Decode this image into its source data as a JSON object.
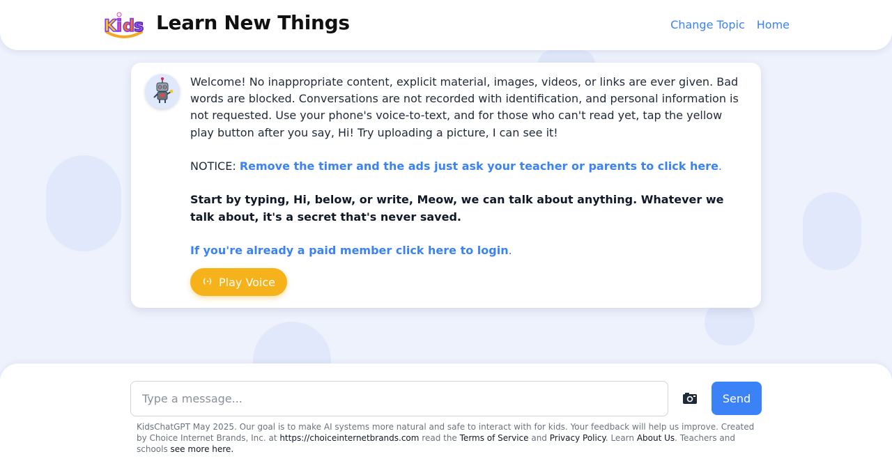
{
  "header": {
    "logo_text": "Kids",
    "title": "Learn New Things",
    "nav": [
      "Change Topic",
      "Home"
    ]
  },
  "message": {
    "intro": "Welcome! No inappropriate content, explicit material, images, videos, or links are ever given. Bad words are blocked. Conversations are not recorded with identification, and personal information is not requested. Use your phone's voice-to-text, and for those who can't read yet, tap the yellow play button after you say, Hi! Try uploading a picture, I can see it!",
    "notice_label": "NOTICE: ",
    "notice_link": "Remove the timer and the ads just ask your teacher or parents to click here",
    "notice_period": ".",
    "start_text": "Start by typing, Hi, below, or write, Meow, we can talk about anything. Whatever we talk about, it's a secret that's never saved.",
    "login_link": "If you're already a paid member click here to login",
    "login_period": ".",
    "play_button": "Play Voice"
  },
  "input": {
    "placeholder": "Type a message...",
    "value": "",
    "send_label": "Send"
  },
  "footer": {
    "text1": "KidsChatGPT May 2025. Our goal is to make AI systems more natural and safe to interact with for kids. Your feedback will help us improve. Created by Choice Internet Brands, Inc. at ",
    "site_link": "https://choiceinternetbrands.com",
    "text2": " read the ",
    "tos_link": "Terms of Service",
    "text3": " and ",
    "privacy_link": "Privacy Policy",
    "text4": ". Learn ",
    "about_link": "About Us",
    "text5": ". Teachers and schools ",
    "more_link": "see more here."
  },
  "colors": {
    "accent": "#3b82f6",
    "play_button": "#f5b21a",
    "background": "#eef2fd"
  },
  "icons": [
    "kids-logo-icon",
    "robot-avatar-icon",
    "sound-wave-icon",
    "camera-icon"
  ]
}
